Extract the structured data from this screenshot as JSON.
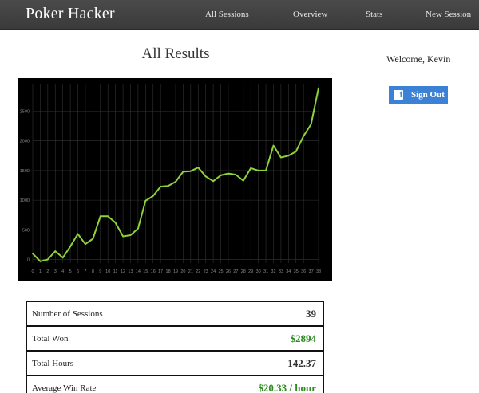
{
  "navbar": {
    "brand": "Poker Hacker",
    "links": [
      "All Sessions",
      "Overview",
      "Stats",
      "New Session"
    ]
  },
  "page": {
    "title": "All Results",
    "welcome": "Welcome, Kevin",
    "signout_label": "Sign Out"
  },
  "colors": {
    "line": "#8fd13a",
    "chart_bg": "#000000",
    "grid": "#333333",
    "tick_text": "#8a8a8a",
    "positive": "#2e8b22",
    "signout_bg": "#3b82d6"
  },
  "chart_data": {
    "type": "line",
    "title": "",
    "xlabel": "",
    "ylabel": "",
    "x": [
      0,
      1,
      2,
      3,
      4,
      5,
      6,
      7,
      8,
      9,
      10,
      11,
      12,
      13,
      14,
      15,
      16,
      17,
      18,
      19,
      20,
      21,
      22,
      23,
      24,
      25,
      26,
      27,
      28,
      29,
      30,
      31,
      32,
      33,
      34,
      35,
      36,
      37,
      38
    ],
    "values": [
      100,
      -30,
      0,
      140,
      30,
      220,
      430,
      260,
      350,
      730,
      730,
      620,
      390,
      410,
      520,
      990,
      1070,
      1230,
      1240,
      1310,
      1480,
      1490,
      1550,
      1400,
      1320,
      1420,
      1450,
      1430,
      1330,
      1540,
      1500,
      1500,
      1920,
      1720,
      1750,
      1820,
      2080,
      2280,
      2890
    ],
    "y_ticks": [
      0,
      500,
      1000,
      1500,
      2000,
      2500
    ],
    "ylim": [
      -60,
      2950
    ],
    "grid": true,
    "legend": "none"
  },
  "stats": [
    {
      "label": "Number of Sessions",
      "value": "39",
      "positive": false
    },
    {
      "label": "Total Won",
      "value": "$2894",
      "positive": true
    },
    {
      "label": "Total Hours",
      "value": "142.37",
      "positive": false
    },
    {
      "label": "Average Win Rate",
      "value": "$20.33 / hour",
      "positive": true
    }
  ]
}
